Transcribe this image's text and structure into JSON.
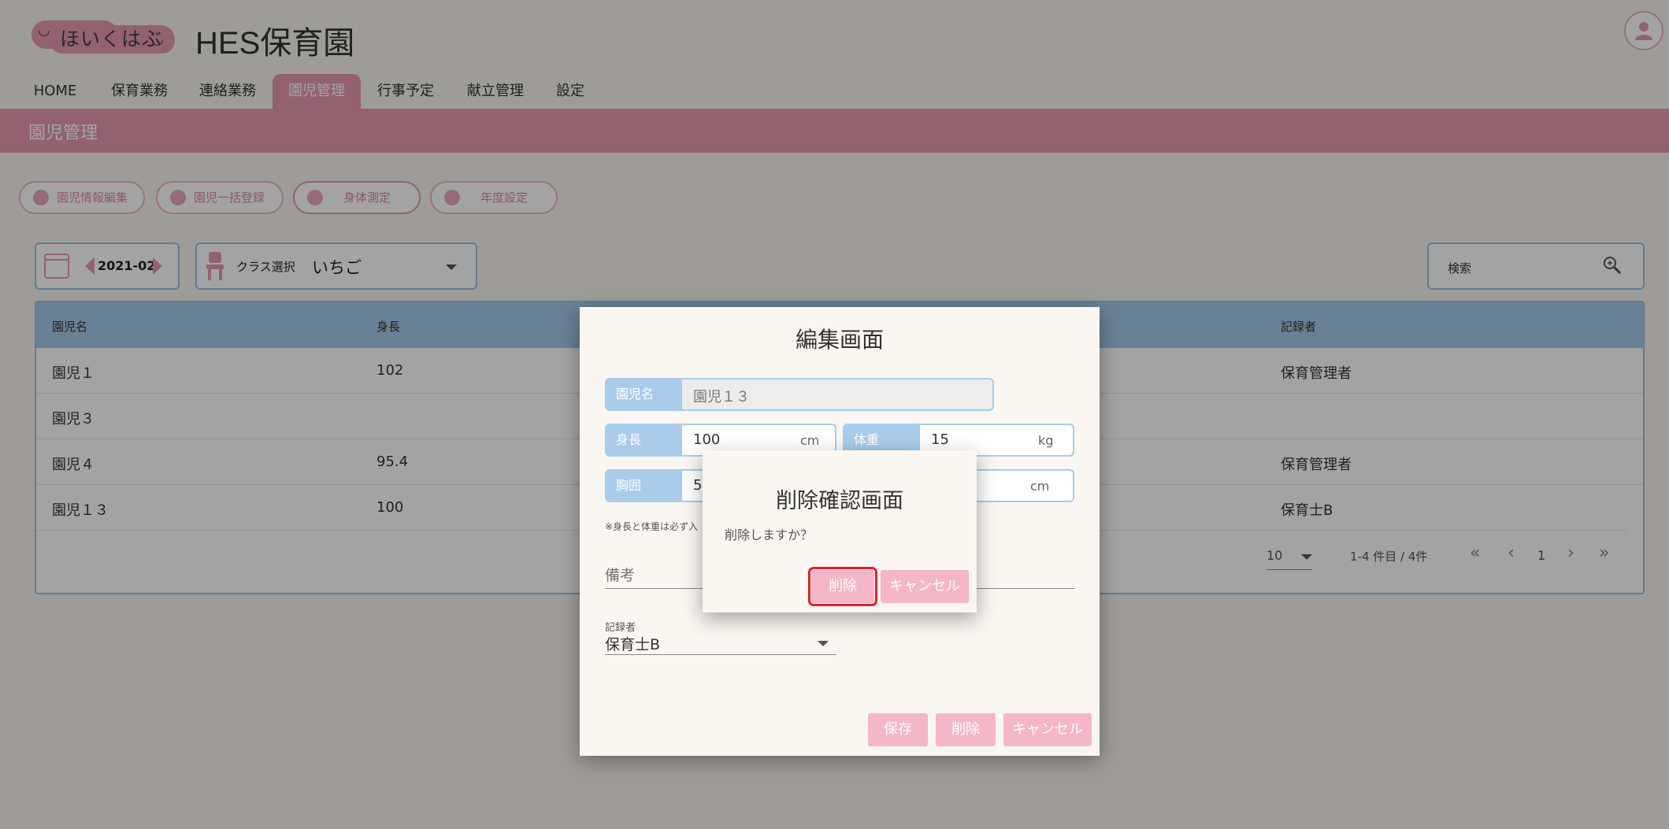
{
  "header": {
    "logo_text": "ほいくはぶ",
    "site_title": "HES保育園"
  },
  "nav": [
    {
      "label": "HOME"
    },
    {
      "label": "保育業務"
    },
    {
      "label": "連絡業務"
    },
    {
      "label": "園児管理"
    },
    {
      "label": "行事予定"
    },
    {
      "label": "献立管理"
    },
    {
      "label": "設定"
    }
  ],
  "nav_active": "園児管理",
  "page_title": "園児管理",
  "sub_buttons": [
    {
      "label": "園児情報編集"
    },
    {
      "label": "園児一括登録"
    },
    {
      "label": "身体測定"
    },
    {
      "label": "年度設定"
    }
  ],
  "filters": {
    "month": "2021-02",
    "class_label": "クラス選択",
    "class_value": "いちご",
    "search_placeholder": "検索"
  },
  "table": {
    "columns": [
      "園児名",
      "身長",
      "記録者"
    ],
    "rows": [
      {
        "name": "園児１",
        "height": "102",
        "recorder": "保育管理者"
      },
      {
        "name": "園児３",
        "height": "",
        "recorder": ""
      },
      {
        "name": "園児４",
        "height": "95.4",
        "recorder": "保育管理者"
      },
      {
        "name": "園児１３",
        "height": "100",
        "recorder": "保育士B"
      }
    ],
    "per_page": "10",
    "range_text": "1-4 件目 / 4件",
    "page": "1"
  },
  "edit_dialog": {
    "title": "編集画面",
    "name_label": "園児名",
    "name_value": "園児１３",
    "height_label": "身長",
    "height_value": "100",
    "height_unit": "cm",
    "weight_label": "体重",
    "weight_value": "15",
    "weight_unit": "kg",
    "chest_label": "胸囲",
    "chest_value": "5",
    "chest_unit": "cm",
    "note": "※身長と体重は必ず入",
    "remarks_label": "備考",
    "recorder_label": "記録者",
    "recorder_value": "保育士B",
    "save_label": "保存",
    "delete_label": "削除",
    "cancel_label": "キャンセル"
  },
  "confirm_dialog": {
    "title": "削除確認画面",
    "message": "削除しますか？",
    "delete_label": "削除",
    "cancel_label": "キャンセル"
  },
  "colors": {
    "accent_pink": "#e59ab0",
    "button_pink": "#f4b6c8",
    "accent_blue": "#a8ccea",
    "highlight_red": "#e0202a"
  }
}
